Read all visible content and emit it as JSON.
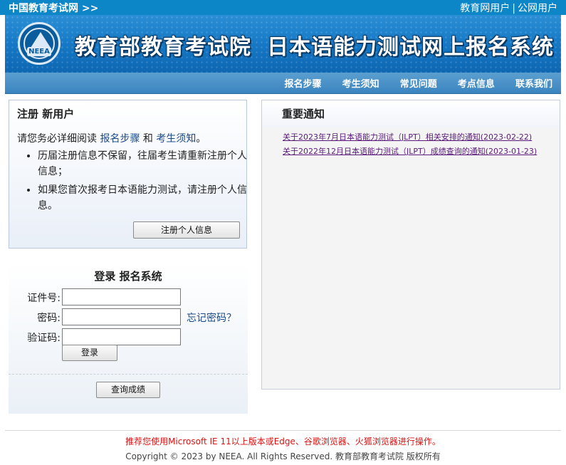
{
  "topbar": {
    "site_link": "中国教育考试网 >>",
    "user_link_1": "教育网用户",
    "separator": "|",
    "user_link_2": "公网用户"
  },
  "banner": {
    "logo_text": "NEEA",
    "title_part1": "教育部教育考试院",
    "title_part2": "日本语能力测试网上报名系统"
  },
  "nav": {
    "items": [
      "报名步骤",
      "考生须知",
      "常见问题",
      "考点信息",
      "联系我们"
    ]
  },
  "register": {
    "title": "注册 新用户",
    "intro_prefix": "请您务必详细阅读 ",
    "intro_link_1": "报名步骤",
    "intro_and": " 和 ",
    "intro_link_2": "考生须知",
    "intro_suffix": "。",
    "bullets": [
      "历届注册信息不保留，往届考生请重新注册个人信息；",
      "如果您首次报考日本语能力测试，请注册个人信息。"
    ],
    "button_label": "注册个人信息"
  },
  "login": {
    "title": "登录 报名系统",
    "id_label": "证件号:",
    "password_label": "密码:",
    "captcha_label": "验证码:",
    "forgot_label": "忘记密码？",
    "login_button": "登录",
    "score_button": "查询成绩"
  },
  "notice": {
    "title": "重要通知",
    "items": [
      "关于2023年7月日本语能力测试（JLPT）相关安排的通知(2023-02-22)",
      "关于2022年12月日本语能力测试（JLPT）成绩查询的通知(2023-01-23)"
    ]
  },
  "footer": {
    "recommendation": "推荐您使用Microsoft IE 11以上版本或Edge、谷歌浏览器、火狐浏览器进行操作。",
    "copyright": "Copyright © 2023 by NEEA. All Rights Reserved. 教育部教育考试院 版权所有"
  }
}
